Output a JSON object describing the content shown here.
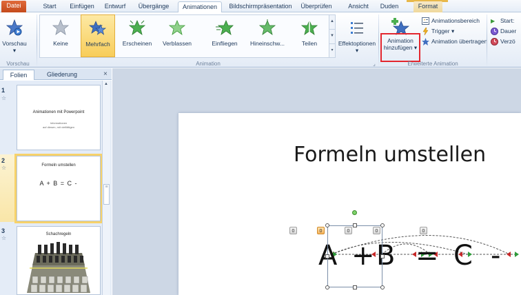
{
  "tabs": [
    {
      "label": "Datei"
    },
    {
      "label": "Start"
    },
    {
      "label": "Einfügen"
    },
    {
      "label": "Entwurf"
    },
    {
      "label": "Übergänge"
    },
    {
      "label": "Animationen"
    },
    {
      "label": "Bildschirmpräsentation"
    },
    {
      "label": "Überprüfen"
    },
    {
      "label": "Ansicht"
    },
    {
      "label": "Duden"
    },
    {
      "label": "Format"
    }
  ],
  "ribbon": {
    "vorschau": {
      "label": "Vorschau",
      "group": "Vorschau"
    },
    "gallery_items": [
      {
        "label": "Keine"
      },
      {
        "label": "Mehrfach",
        "selected": true
      },
      {
        "label": "Erscheinen"
      },
      {
        "label": "Verblassen"
      },
      {
        "label": "Einfliegen"
      },
      {
        "label": "Hineinschw..."
      },
      {
        "label": "Teilen"
      }
    ],
    "effektoptionen": "Effektoptionen",
    "animation_group": "Animation",
    "add_animation_line1": "Animation",
    "add_animation_line2": "hinzufügen",
    "animationsbereich": "Animationsbereich",
    "trigger": "Trigger",
    "animation_uebertragen": "Animation übertragen",
    "erweiterte_group": "Erweiterte Animation",
    "start": "Start:",
    "dauer": "Dauer",
    "verzoegerung": "Verzö"
  },
  "pane": {
    "tab_folien": "Folien",
    "tab_gliederung": "Gliederung",
    "close": "×",
    "slides": [
      {
        "num": "1",
        "title": "Animationen mit Powerpoint",
        "subtitle_1": "Informationen",
        "subtitle_2": "auf diesen, mit vielfältigen"
      },
      {
        "num": "2",
        "title": "Formeln umstellen",
        "equation": "A + B  =  C  -"
      },
      {
        "num": "3",
        "title": "Schachregeln"
      }
    ]
  },
  "slide": {
    "title": "Formeln umstellen",
    "equation": {
      "a": "A",
      "plus": "+",
      "b": "B",
      "eq": "=",
      "c": "C",
      "minus": "-"
    },
    "tags": [
      "0",
      "0",
      "0",
      "0",
      "0"
    ]
  },
  "colors": {
    "file_tab": "#c44a1b",
    "accent": "#e3262e",
    "selected": "#f8cd5a"
  }
}
